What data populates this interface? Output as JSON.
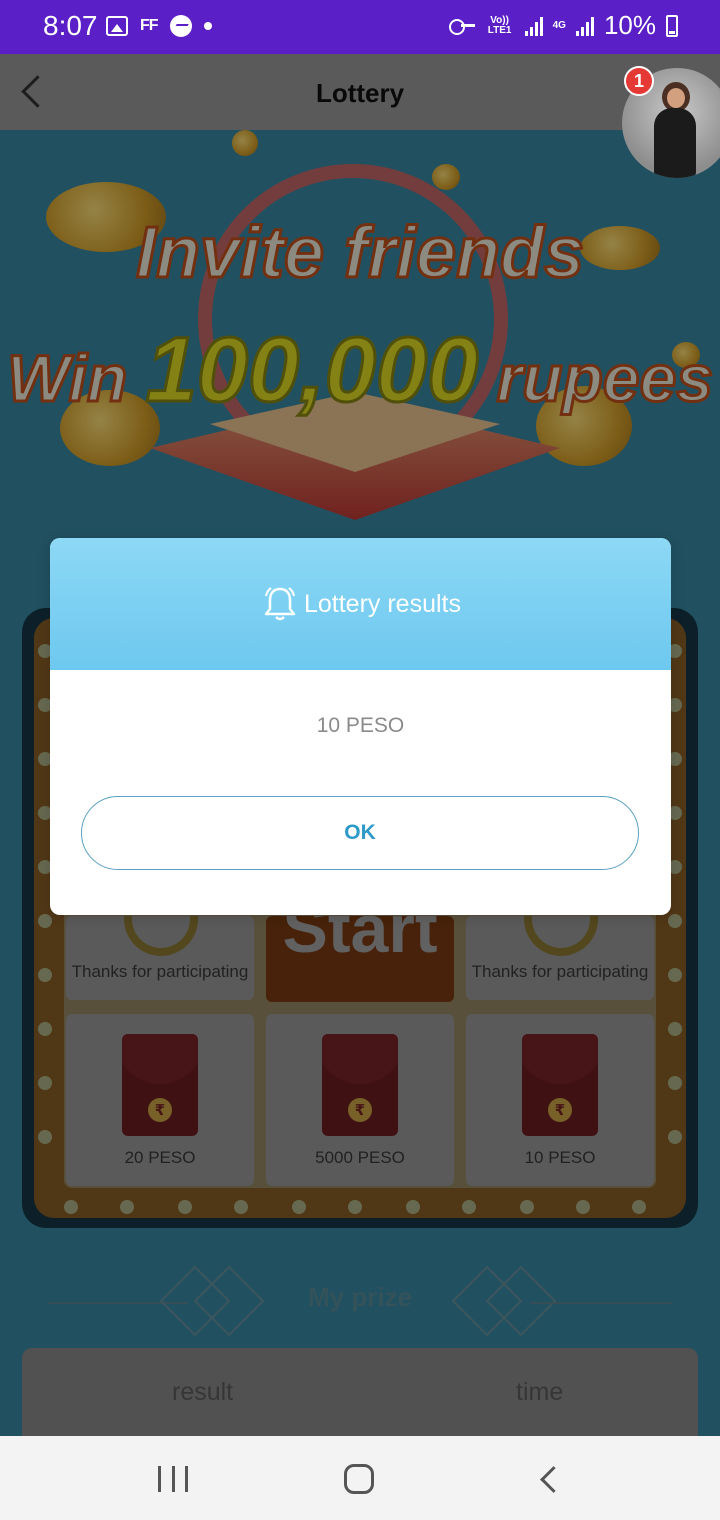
{
  "status_bar": {
    "time": "8:07",
    "ff_label": "FF",
    "volte_label": "Vo)) LTE1",
    "network_label": "4G",
    "battery": "10%"
  },
  "header": {
    "title": "Lottery",
    "notification_count": "1"
  },
  "banner": {
    "line1": "Invite friends",
    "line2_prefix": "Win",
    "line2_amount": "100,000",
    "line2_suffix": "rupees"
  },
  "lottery_board": {
    "start_label": "Start",
    "cells": [
      {
        "label": "Thanks for participating",
        "type": "ring"
      },
      {
        "label": "Thanks for participating",
        "type": "ring"
      },
      {
        "label": "20 PESO",
        "type": "envelope"
      },
      {
        "label": "5000 PESO",
        "type": "envelope"
      },
      {
        "label": "10 PESO",
        "type": "envelope"
      }
    ]
  },
  "my_prize": {
    "title": "My prize",
    "columns": [
      "result",
      "time"
    ]
  },
  "dialog": {
    "title": "Lottery results",
    "message": "10 PESO",
    "ok_label": "OK"
  },
  "colors": {
    "status_bar": "#5a1fc7",
    "dialog_header": "#7ccdf2",
    "ok_text": "#2e9ac9"
  },
  "icons": {
    "bell": "bell-icon",
    "back": "chevron-left-icon",
    "rupee": "rupee-icon"
  }
}
